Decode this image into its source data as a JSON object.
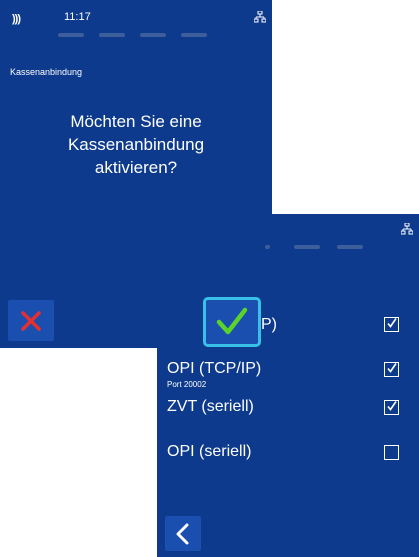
{
  "status_bar": {
    "time": "11:17",
    "nfc_icon": "contactless-icon",
    "network_icon": "network-icon"
  },
  "dialog": {
    "breadcrumb": "Kassenanbindung",
    "question_line1": "Möchten Sie eine",
    "question_line2": "Kassenanbindung",
    "question_line3": "aktivieren?"
  },
  "options": [
    {
      "label": "P)",
      "sublabel": "",
      "checked": true
    },
    {
      "label": "OPI (TCP/IP)",
      "sublabel": "Port 20002",
      "checked": true
    },
    {
      "label": "ZVT (seriell)",
      "sublabel": "",
      "checked": true
    },
    {
      "label": "OPI (seriell)",
      "sublabel": "",
      "checked": false
    }
  ],
  "colors": {
    "background": "#0d3a8c",
    "button": "#1a4fb0",
    "confirm": "#5bd42a",
    "cancel": "#e53030",
    "focus": "#38c0e8"
  }
}
